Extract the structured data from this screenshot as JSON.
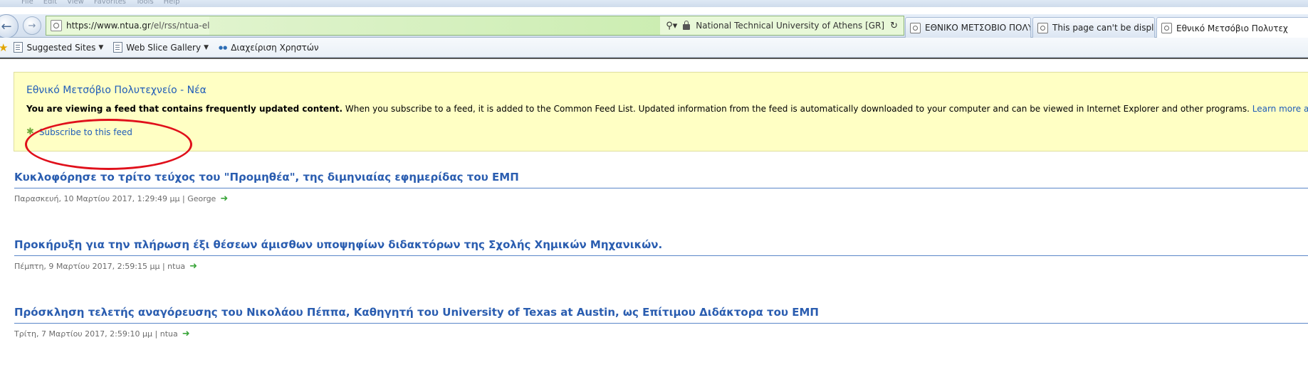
{
  "browser": {
    "menu": [
      "File",
      "Edit",
      "View",
      "Favorites",
      "Tools",
      "Help"
    ],
    "url": {
      "main": "https://www.ntua.gr",
      "path": "/el/rss/ntua-el"
    },
    "site_identity": "National Technical University of Athens [GR]",
    "tabs": [
      {
        "label": "ΕΘΝΙΚΟ ΜΕΤΣΟΒΙΟ ΠΟΛΥΤΕΧ..."
      },
      {
        "label": "This page can't be displayed"
      },
      {
        "label": "Εθνικό Μετσόβιο Πολυτεχ"
      }
    ],
    "favorites": [
      {
        "label": "Suggested Sites"
      },
      {
        "label": "Web Slice Gallery"
      },
      {
        "label": "Διαχείριση Χρηστών"
      }
    ]
  },
  "feed": {
    "title": "Εθνικό Μετσόβιο Πολυτεχνείο - Νέα",
    "notice_bold": "You are viewing a feed that contains frequently updated content.",
    "notice_rest": " When you subscribe to a feed, it is added to the Common Feed List. Updated information from the feed is automatically downloaded to your computer and can be viewed in Internet Explorer and other programs. ",
    "learn_more": "Learn more about feeds.",
    "subscribe": "Subscribe to this feed"
  },
  "items": [
    {
      "title": "Κυκλοφόρησε το τρίτο τεύχος του \"Προμηθέα\", της διμηνιαίας εφημερίδας του ΕΜΠ",
      "meta": "Παρασκευή, 10 Μαρτίου 2017, 1:29:49 μμ | George"
    },
    {
      "title": "Προκήρυξη για την πλήρωση έξι θέσεων άμισθων υποψηφίων διδακτόρων της Σχολής Χημικών Μηχανικών.",
      "meta": "Πέμπτη, 9 Μαρτίου 2017, 2:59:15 μμ | ntua"
    },
    {
      "title": "Πρόσκληση τελετής αναγόρευσης του Νικολάου Πέππα, Καθηγητή του University of Texas at Austin, ως Επίτιμου Διδάκτορα του ΕΜΠ",
      "meta": "Τρίτη, 7 Μαρτίου 2017, 2:59:10 μμ | ntua"
    }
  ]
}
